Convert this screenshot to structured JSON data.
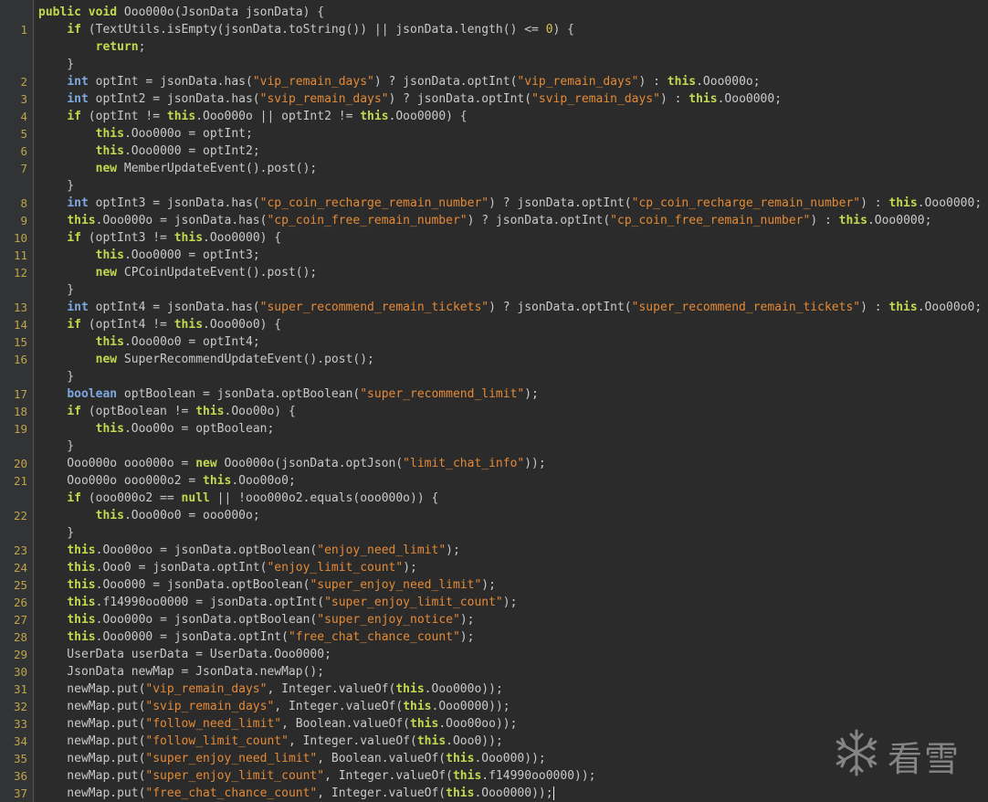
{
  "editor": {
    "lines": [
      {
        "n": "",
        "code": "    public void Ooo000o(JsonData jsonData) {"
      },
      {
        "n": "1",
        "code": "        if (TextUtils.isEmpty(jsonData.toString()) || jsonData.length() <= 0) {"
      },
      {
        "n": "",
        "code": "            return;"
      },
      {
        "n": "",
        "code": "        }"
      },
      {
        "n": "2",
        "code": "        int optInt = jsonData.has(\"vip_remain_days\") ? jsonData.optInt(\"vip_remain_days\") : this.Ooo000o;"
      },
      {
        "n": "3",
        "code": "        int optInt2 = jsonData.has(\"svip_remain_days\") ? jsonData.optInt(\"svip_remain_days\") : this.Ooo0000;"
      },
      {
        "n": "4",
        "code": "        if (optInt != this.Ooo000o || optInt2 != this.Ooo0000) {"
      },
      {
        "n": "5",
        "code": "            this.Ooo000o = optInt;"
      },
      {
        "n": "6",
        "code": "            this.Ooo0000 = optInt2;"
      },
      {
        "n": "7",
        "code": "            new MemberUpdateEvent().post();"
      },
      {
        "n": "",
        "code": "        }"
      },
      {
        "n": "8",
        "code": "        int optInt3 = jsonData.has(\"cp_coin_recharge_remain_number\") ? jsonData.optInt(\"cp_coin_recharge_remain_number\") : this.Ooo0000;"
      },
      {
        "n": "9",
        "code": "        this.Ooo000o = jsonData.has(\"cp_coin_free_remain_number\") ? jsonData.optInt(\"cp_coin_free_remain_number\") : this.Ooo0000;"
      },
      {
        "n": "10",
        "code": "        if (optInt3 != this.Ooo0000) {"
      },
      {
        "n": "11",
        "code": "            this.Ooo0000 = optInt3;"
      },
      {
        "n": "12",
        "code": "            new CPCoinUpdateEvent().post();"
      },
      {
        "n": "",
        "code": "        }"
      },
      {
        "n": "13",
        "code": "        int optInt4 = jsonData.has(\"super_recommend_remain_tickets\") ? jsonData.optInt(\"super_recommend_remain_tickets\") : this.Ooo00o0;"
      },
      {
        "n": "14",
        "code": "        if (optInt4 != this.Ooo00o0) {"
      },
      {
        "n": "15",
        "code": "            this.Ooo00o0 = optInt4;"
      },
      {
        "n": "16",
        "code": "            new SuperRecommendUpdateEvent().post();"
      },
      {
        "n": "",
        "code": "        }"
      },
      {
        "n": "17",
        "code": "        boolean optBoolean = jsonData.optBoolean(\"super_recommend_limit\");"
      },
      {
        "n": "18",
        "code": "        if (optBoolean != this.Ooo00o) {"
      },
      {
        "n": "19",
        "code": "            this.Ooo00o = optBoolean;"
      },
      {
        "n": "",
        "code": "        }"
      },
      {
        "n": "20",
        "code": "        Ooo000o ooo000o = new Ooo000o(jsonData.optJson(\"limit_chat_info\"));"
      },
      {
        "n": "21",
        "code": "        Ooo000o ooo000o2 = this.Ooo00o0;"
      },
      {
        "n": "",
        "code": "        if (ooo000o2 == null || !ooo000o2.equals(ooo000o)) {"
      },
      {
        "n": "22",
        "code": "            this.Ooo00o0 = ooo000o;"
      },
      {
        "n": "",
        "code": "        }"
      },
      {
        "n": "23",
        "code": "        this.Ooo00oo = jsonData.optBoolean(\"enjoy_need_limit\");"
      },
      {
        "n": "24",
        "code": "        this.Ooo0 = jsonData.optInt(\"enjoy_limit_count\");"
      },
      {
        "n": "25",
        "code": "        this.Ooo000 = jsonData.optBoolean(\"super_enjoy_need_limit\");"
      },
      {
        "n": "26",
        "code": "        this.f14990oo0000 = jsonData.optInt(\"super_enjoy_limit_count\");"
      },
      {
        "n": "27",
        "code": "        this.Ooo000o = jsonData.optBoolean(\"super_enjoy_notice\");"
      },
      {
        "n": "28",
        "code": "        this.Ooo0000 = jsonData.optInt(\"free_chat_chance_count\");"
      },
      {
        "n": "29",
        "code": "        UserData userData = UserData.Ooo0000;"
      },
      {
        "n": "30",
        "code": "        JsonData newMap = JsonData.newMap();"
      },
      {
        "n": "31",
        "code": "        newMap.put(\"vip_remain_days\", Integer.valueOf(this.Ooo000o));"
      },
      {
        "n": "32",
        "code": "        newMap.put(\"svip_remain_days\", Integer.valueOf(this.Ooo0000));"
      },
      {
        "n": "33",
        "code": "        newMap.put(\"follow_need_limit\", Boolean.valueOf(this.Ooo00oo));"
      },
      {
        "n": "34",
        "code": "        newMap.put(\"follow_limit_count\", Integer.valueOf(this.Ooo0));"
      },
      {
        "n": "35",
        "code": "        newMap.put(\"super_enjoy_need_limit\", Boolean.valueOf(this.Ooo000));"
      },
      {
        "n": "36",
        "code": "        newMap.put(\"super_enjoy_limit_count\", Integer.valueOf(this.f14990oo0000));"
      },
      {
        "n": "37",
        "code": "        newMap.put(\"free_chat_chance_count\", Integer.valueOf(this.Ooo0000));"
      }
    ]
  },
  "watermark": {
    "text": "看雪",
    "icon": "snowflake-icon"
  },
  "colors": {
    "background": "#2b2b2b",
    "gutter": "#313335",
    "line_number": "#bfa44a",
    "keyword": "#c3d94e",
    "type": "#7fa8e0",
    "string": "#e48a36",
    "number": "#d8c44d",
    "text": "#c9c9c9"
  }
}
